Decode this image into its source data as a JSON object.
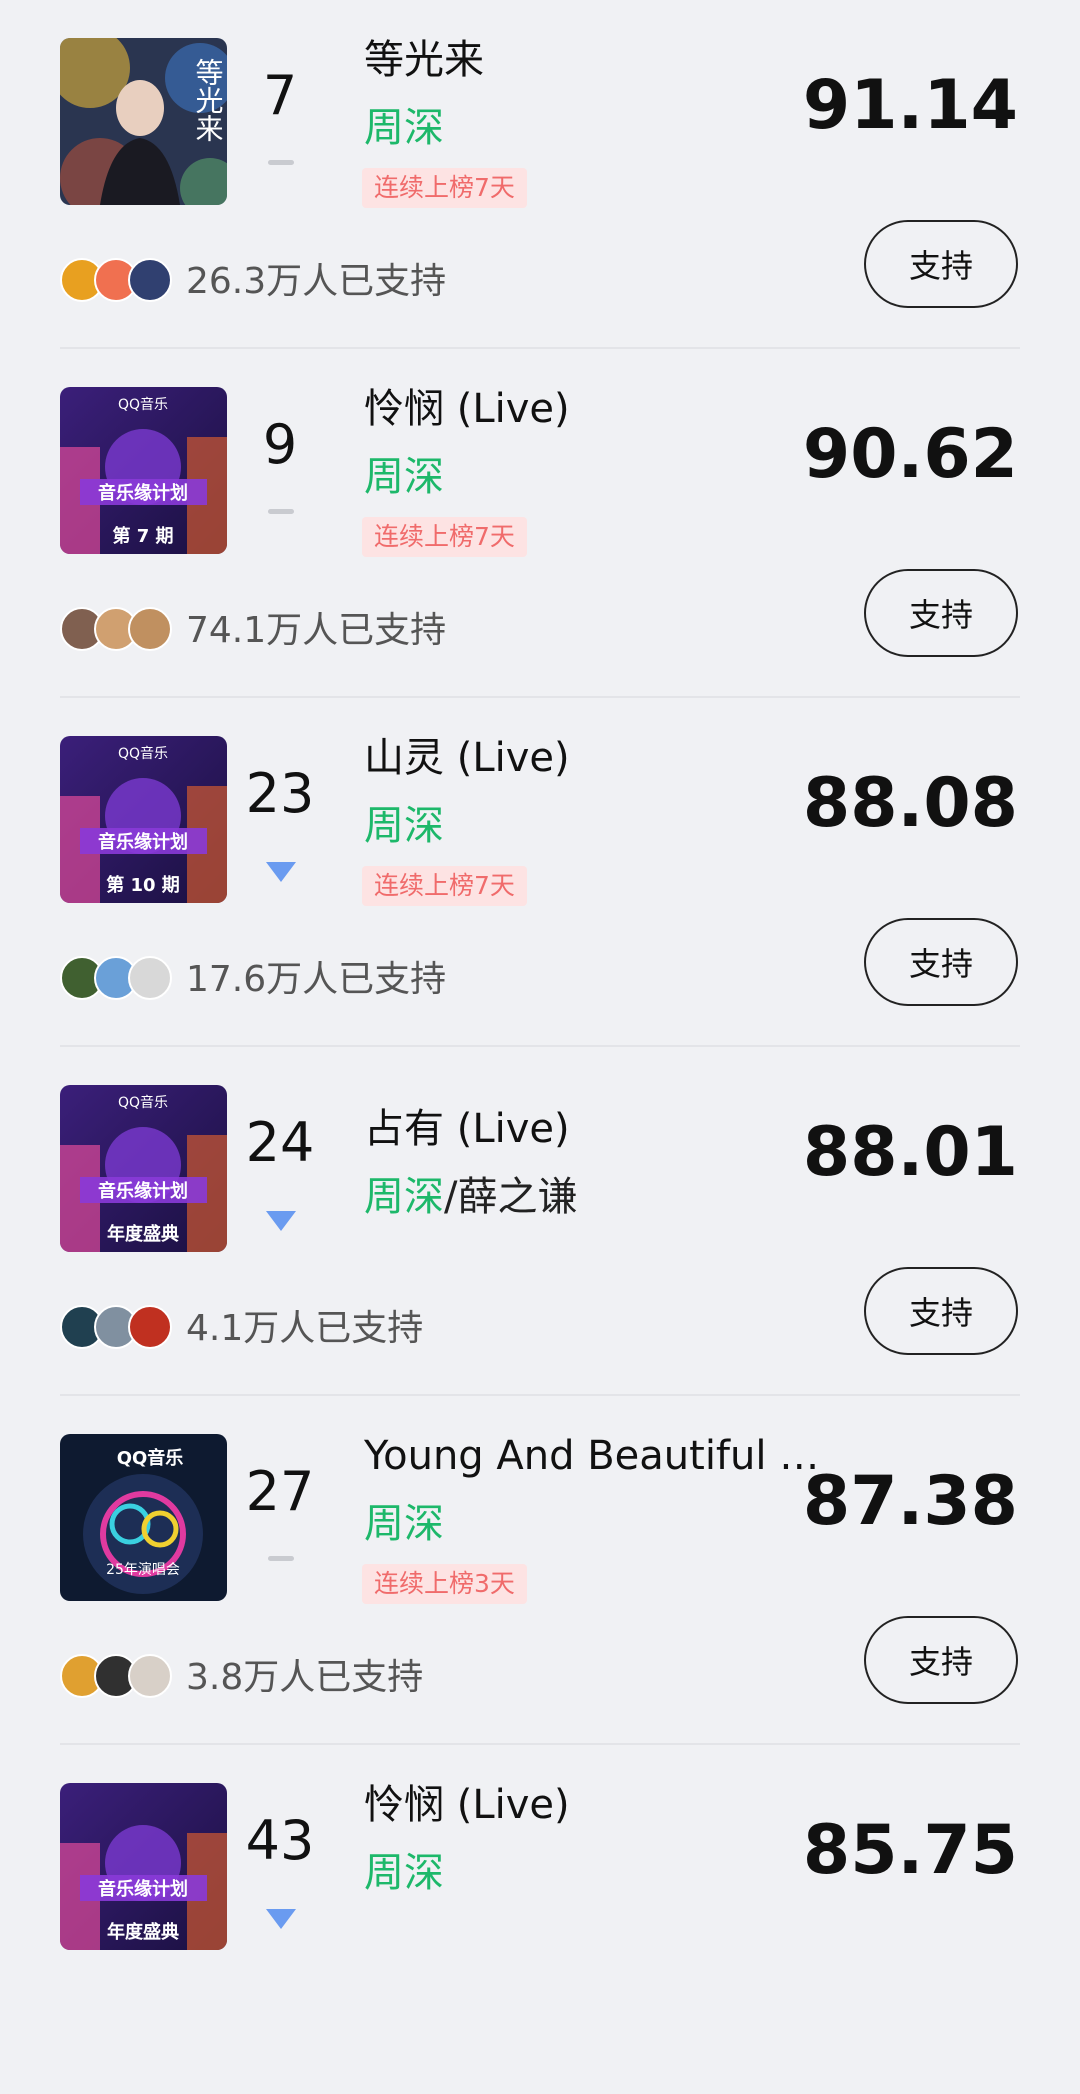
{
  "entries": [
    {
      "rank": "7",
      "trend": "flat",
      "title": "等光来",
      "artist": "周深",
      "co_artist": "",
      "streak": "连续上榜7天",
      "score": "91.14",
      "supporters": "26.3万人已支持",
      "support_label": "支持",
      "cover_text": "等光来"
    },
    {
      "rank": "9",
      "trend": "flat",
      "title": "怜悯 (Live)",
      "artist": "周深",
      "co_artist": "",
      "streak": "连续上榜7天",
      "score": "90.62",
      "supporters": "74.1万人已支持",
      "support_label": "支持",
      "cover_text": "第 7 期"
    },
    {
      "rank": "23",
      "trend": "down",
      "title": "山灵 (Live)",
      "artist": "周深",
      "co_artist": "",
      "streak": "连续上榜7天",
      "score": "88.08",
      "supporters": "17.6万人已支持",
      "support_label": "支持",
      "cover_text": "第 10 期"
    },
    {
      "rank": "24",
      "trend": "down",
      "title": "占有 (Live)",
      "artist": "周深",
      "co_artist": "薛之谦",
      "streak": "",
      "score": "88.01",
      "supporters": "4.1万人已支持",
      "support_label": "支持",
      "cover_text": "年度盛典"
    },
    {
      "rank": "27",
      "trend": "flat",
      "title": "Young And Beautiful …",
      "artist": "周深",
      "co_artist": "",
      "streak": "连续上榜3天",
      "score": "87.38",
      "supporters": "3.8万人已支持",
      "support_label": "支持",
      "cover_text": "QQ音乐"
    },
    {
      "rank": "43",
      "trend": "down",
      "title": "怜悯 (Live)",
      "artist": "周深",
      "co_artist": "",
      "streak": "",
      "score": "85.75",
      "supporters": "",
      "support_label": "",
      "cover_text": "年度盛典"
    }
  ],
  "colors": {
    "artist_green": "#1db86a",
    "streak_text": "#f06b6b",
    "streak_bg": "#fde3e3",
    "trend_down": "#6a9bf0",
    "background": "#f0f1f4"
  },
  "icons": {
    "trend_flat": "dash-icon",
    "trend_down": "down-triangle-icon"
  }
}
